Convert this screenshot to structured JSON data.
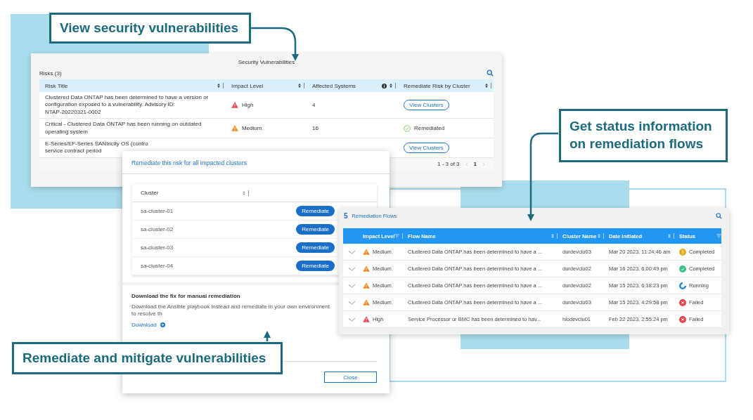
{
  "callouts": [
    {
      "text": "View security vulnerabilities"
    },
    {
      "text": "Get status information on remediation flows"
    },
    {
      "text": "Remediate and mitigate vulnerabilities"
    }
  ],
  "vulnerabilities": {
    "title": "Security Vulnerabilities",
    "risks_label": "Risks (3)",
    "columns": [
      "Risk Title",
      "Impact Level",
      "Affected Systems",
      "Remediate Risk by Cluster"
    ],
    "rows": [
      {
        "title_lines": [
          "Clustered Data ONTAP has been determined to have a version or",
          "configuration exposed to a vulnerability. Advisory ID:",
          "NTAP-20220321-0002"
        ],
        "impact": {
          "text": "High",
          "color": "#e5484d"
        },
        "affected": "4",
        "remediation": {
          "kind": "button",
          "text": "View Clusters"
        }
      },
      {
        "title_lines": [
          "Critical - Clustered Data ONTAP has been running on outdated",
          "operating system"
        ],
        "impact": {
          "text": "Medium",
          "color": "#f08a24"
        },
        "affected": "16",
        "remediation": {
          "kind": "done",
          "text": "Remediated"
        }
      },
      {
        "title_lines": [
          "E-Series/EF-Series SANtricity OS (contro",
          "service contract period"
        ],
        "remediation": {
          "kind": "button",
          "text": "View Clusters"
        }
      }
    ],
    "pagination": {
      "range": "1 - 3 of 3",
      "page": "1"
    }
  },
  "remediate_dialog": {
    "title": "Remediate this risk for all impacted clusters",
    "column": "Cluster",
    "clusters": [
      {
        "name": "sa-cluster-01",
        "action": "Remediate"
      },
      {
        "name": "sa-cluster-02",
        "action": "Remediate"
      },
      {
        "name": "sa-cluster-03",
        "action": "Remediate"
      },
      {
        "name": "sa-cluster-04",
        "action": "Remediate"
      }
    ],
    "manual_heading": "Download the fix for manual remediation",
    "manual_text": "Download the Ansible playbook instead and remediate in your own environment to resolve th",
    "download_link": "Download",
    "close": "Close"
  },
  "flows": {
    "count": "5",
    "title": "Remediation Flows",
    "columns": [
      "Impact Level",
      "Flow Name",
      "Cluster Name",
      "Date Initiated",
      "Status"
    ],
    "rows": [
      {
        "impact": {
          "text": "Medium",
          "color": "#f08a24"
        },
        "flow": "Clustered Data ONTAP has been determined to have a ...",
        "cluster": "durdevclu03",
        "date": "Mar 20 2023, 11:24:46 am",
        "status": {
          "kind": "alert",
          "color": "#e0b020",
          "text": "Completed"
        }
      },
      {
        "impact": {
          "text": "Medium",
          "color": "#f08a24"
        },
        "flow": "Clustered Data ONTAP has been determined to have a ...",
        "cluster": "durdevclu02",
        "date": "Mar 16 2023, 6:00:49 pm",
        "status": {
          "kind": "check",
          "color": "#3cc08a",
          "text": "Completed"
        }
      },
      {
        "impact": {
          "text": "Medium",
          "color": "#f08a24"
        },
        "flow": "Clustered Data ONTAP has been determined to have a ...",
        "cluster": "durdevclu02",
        "date": "Mar 15 2023, 6:18:23 pm",
        "status": {
          "kind": "spinner",
          "color": "#2a8ae0",
          "text": "Running"
        }
      },
      {
        "impact": {
          "text": "Medium",
          "color": "#f08a24"
        },
        "flow": "Clustered Data ONTAP has been determined to have a ...",
        "cluster": "durdevclu03",
        "date": "Mar 15 2023, 4:29:58 pm",
        "status": {
          "kind": "error",
          "color": "#e5484d",
          "text": "Failed"
        }
      },
      {
        "impact": {
          "text": "High",
          "color": "#e5484d"
        },
        "flow": "Service Processor or BMC has been determined to hav...",
        "cluster": "hiodevclu01",
        "date": "Feb 22 2023, 2:55:24 pm",
        "status": {
          "kind": "error",
          "color": "#e5484d",
          "text": "Failed"
        }
      }
    ]
  }
}
